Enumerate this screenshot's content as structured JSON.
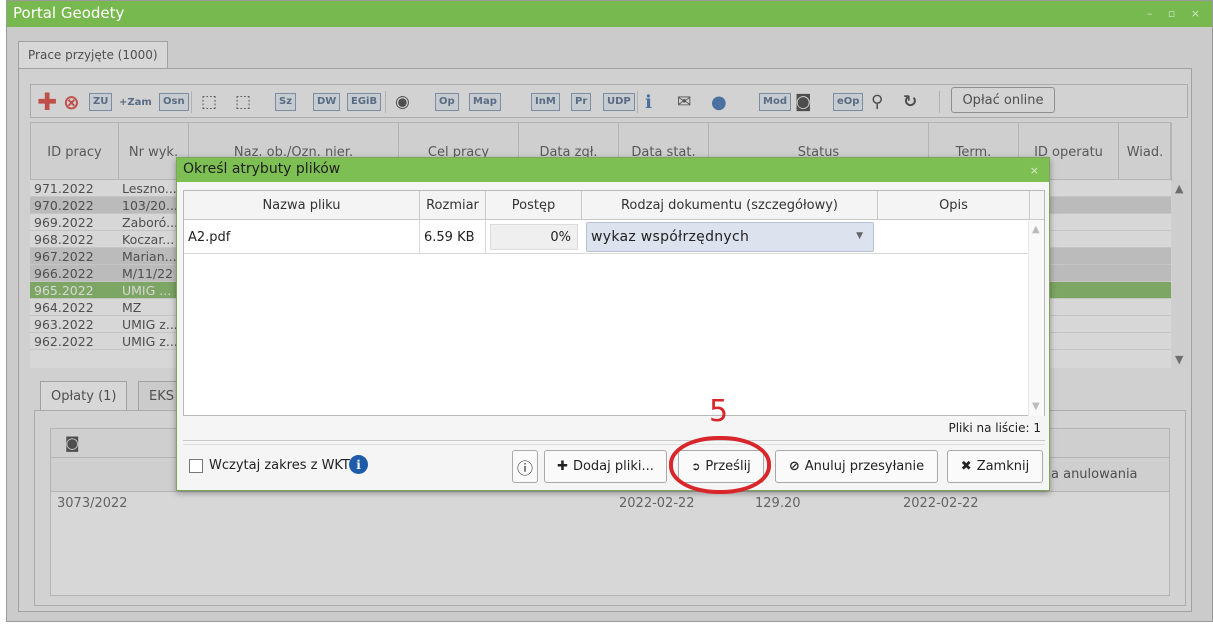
{
  "window": {
    "title": "Portal Geodety",
    "controls": "– ▫ ×"
  },
  "main_tab": "Prace przyjęte (1000)",
  "toolbar": {
    "buttons": [
      {
        "label": "✚",
        "icon": "add-icon"
      },
      {
        "label": "⊗",
        "icon": "cancel-icon"
      },
      {
        "label": "ZU"
      },
      {
        "label": "+Zam"
      },
      {
        "label": "Osn"
      },
      {
        "label": "⬚",
        "icon": "search-area-icon"
      },
      {
        "label": "⬚",
        "icon": "edit-area-icon"
      },
      {
        "label": "Sz"
      },
      {
        "label": "DW"
      },
      {
        "label": "EGiB"
      },
      {
        "label": "◉",
        "icon": "camera-icon"
      },
      {
        "label": "Op"
      },
      {
        "label": "Map"
      },
      {
        "label": "InM"
      },
      {
        "label": "Pr"
      },
      {
        "label": "UDP"
      },
      {
        "label": "ℹ",
        "icon": "info-icon"
      },
      {
        "label": "✉",
        "icon": "mail-icon"
      },
      {
        "label": "●",
        "icon": "chat-icon"
      },
      {
        "label": "Mod"
      },
      {
        "label": "◙",
        "icon": "photo-icon"
      },
      {
        "label": "eOp"
      },
      {
        "label": "⚲",
        "icon": "binoculars-icon"
      },
      {
        "label": "↻",
        "icon": "refresh-icon"
      }
    ],
    "pay_online": "Opłać online"
  },
  "grid": {
    "headers": [
      "ID pracy",
      "Nr wyk.",
      "Naz. ob./Ozn. nier.",
      "Cel pracy",
      "Data zgł.",
      "Data stat.",
      "Status",
      "Term.",
      "ID operatu",
      "Wiad."
    ],
    "rows": [
      {
        "id": "971.2022",
        "nr": "Leszno..."
      },
      {
        "id": "970.2022",
        "nr": "103/20..."
      },
      {
        "id": "969.2022",
        "nr": "Zaboró..."
      },
      {
        "id": "968.2022",
        "nr": "Koczar..."
      },
      {
        "id": "967.2022",
        "nr": "Marian..."
      },
      {
        "id": "966.2022",
        "nr": "M/11/22"
      },
      {
        "id": "965.2022",
        "nr": "UMIG ..."
      },
      {
        "id": "964.2022",
        "nr": "MZ"
      },
      {
        "id": "963.2022",
        "nr": "UMIG z..."
      },
      {
        "id": "962.2022",
        "nr": "UMIG z..."
      }
    ]
  },
  "subtabs": [
    "Opłaty (1)",
    "EKS"
  ],
  "lower": {
    "column_partial": "a anulowania",
    "row": [
      "3073/2022",
      "2022-02-22",
      "129.20",
      "2022-02-22"
    ]
  },
  "dialog": {
    "title": "Określ atrybuty plików",
    "close": "×",
    "headers": [
      "Nazwa pliku",
      "Rozmiar",
      "Postęp",
      "Rodzaj dokumentu (szczegółowy)",
      "Opis"
    ],
    "file": {
      "name": "A2.pdf",
      "size": "6.59 KB",
      "progress_text": "0%",
      "progress": 0,
      "doc_type": "wykaz współrzędnych",
      "description": ""
    },
    "count": "Pliki na liście: 1",
    "checkbox_label": "Wczytaj zakres z WKT",
    "buttons": {
      "info": "ⓘ",
      "add": "Dodaj pliki...",
      "send": "Prześlij",
      "cancel_upload": "Anuluj przesyłanie",
      "close": "Zamknij"
    }
  },
  "annotation": {
    "step": "5",
    "color": "#d8262b"
  },
  "colors": {
    "titlebar": "#77b94e",
    "selected_row": "#6fae45",
    "accent_blue": "#1e5ba8"
  }
}
